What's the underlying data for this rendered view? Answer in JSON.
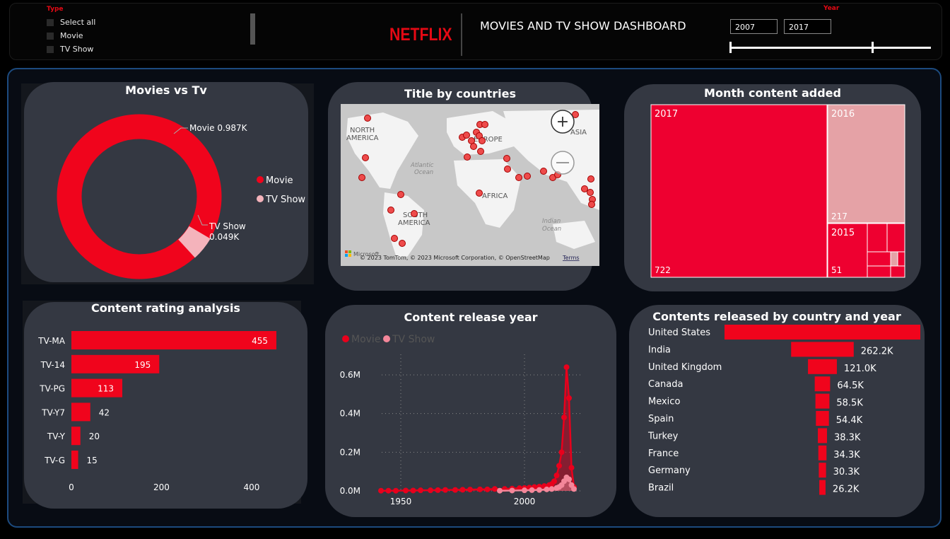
{
  "header": {
    "type_label": "Type",
    "type_options": [
      "Select all",
      "Movie",
      "TV Show"
    ],
    "logo": "NETFLIX",
    "title": "MOVIES AND TV SHOW DASHBOARD",
    "year_label": "Year",
    "year_start": "2007",
    "year_end": "2017"
  },
  "donut": {
    "title": "Movies vs Tv",
    "legend": [
      "Movie",
      "TV Show"
    ],
    "label_movie": "Movie 0.987K",
    "label_tv_line1": "TV Show",
    "label_tv_line2": "0.049K",
    "colors": {
      "Movie": "#f0041c",
      "TV Show": "#f4b3bb"
    }
  },
  "map": {
    "title": "Title by countries",
    "labels": {
      "north_america": "NORTH AMERICA",
      "europe": "EUROPE",
      "asia": "ASIA",
      "africa": "AFRICA",
      "south_america": "SOUTH AMERICA",
      "atlantic": "Atlantic Ocean",
      "indian": "Indian Ocean"
    },
    "attribution": "© 2023 TomTom, © 2023 Microsoft Corporation, © OpenStreetMap",
    "terms": "Terms",
    "ms_logo_text": "Microsoft"
  },
  "treemap": {
    "title": "Month content added",
    "tiles": [
      {
        "label": "2017",
        "value": "722",
        "color": "#ee0030"
      },
      {
        "label": "2016",
        "value": "217",
        "color": "#e5a2a6"
      },
      {
        "label": "2015",
        "value": "51",
        "color": "#ee0030"
      }
    ]
  },
  "chart_data": [
    {
      "type": "donut",
      "title": "Movies vs Tv",
      "categories": [
        "Movie",
        "TV Show"
      ],
      "values": [
        987,
        49
      ],
      "legend": "right"
    },
    {
      "type": "bar",
      "orientation": "horizontal",
      "title": "Content rating analysis",
      "categories": [
        "TV-MA",
        "TV-14",
        "TV-PG",
        "TV-Y7",
        "TV-Y",
        "TV-G"
      ],
      "values": [
        455,
        195,
        113,
        42,
        20,
        15
      ],
      "xticks": [
        "0",
        "200",
        "400"
      ],
      "xlim": [
        0,
        470
      ],
      "color": "#f0041c"
    },
    {
      "type": "line",
      "title": "Content release year",
      "legend": [
        "Movie",
        "TV Show"
      ],
      "series_colors": {
        "Movie": "#e8001c",
        "TV Show": "#f4879a"
      },
      "yticks": [
        "0.0M",
        "0.2M",
        "0.4M",
        "0.6M"
      ],
      "xticks": [
        "1950",
        "2000"
      ],
      "xlim": [
        1940,
        2022
      ],
      "ylim": [
        0,
        0.7
      ],
      "series": [
        {
          "name": "Movie",
          "x": [
            1942,
            1945,
            1948,
            1952,
            1955,
            1958,
            1962,
            1965,
            1968,
            1972,
            1975,
            1978,
            1982,
            1985,
            1988,
            1992,
            1995,
            1998,
            2000,
            2002,
            2004,
            2006,
            2008,
            2010,
            2011,
            2012,
            2013,
            2014,
            2015,
            2016,
            2017,
            2018,
            2019,
            2020
          ],
          "y": [
            0.001,
            0.001,
            0.001,
            0.002,
            0.002,
            0.003,
            0.003,
            0.004,
            0.005,
            0.005,
            0.006,
            0.007,
            0.008,
            0.008,
            0.01,
            0.01,
            0.012,
            0.014,
            0.015,
            0.017,
            0.02,
            0.022,
            0.025,
            0.03,
            0.035,
            0.05,
            0.08,
            0.13,
            0.2,
            0.38,
            0.64,
            0.48,
            0.12,
            0.02
          ]
        },
        {
          "name": "TV Show",
          "x": [
            1990,
            1995,
            2000,
            2003,
            2006,
            2009,
            2011,
            2013,
            2014,
            2015,
            2016,
            2017,
            2018,
            2019,
            2020
          ],
          "y": [
            0.001,
            0.002,
            0.003,
            0.004,
            0.005,
            0.008,
            0.01,
            0.015,
            0.02,
            0.03,
            0.05,
            0.07,
            0.06,
            0.03,
            0.01
          ]
        }
      ]
    },
    {
      "type": "bar",
      "orientation": "horizontal",
      "title": "Contents released by country and year",
      "categories": [
        "United States",
        "India",
        "United Kingdom",
        "Canada",
        "Mexico",
        "Spain",
        "Turkey",
        "France",
        "Germany",
        "Brazil"
      ],
      "values": [
        820,
        262.2,
        121.0,
        64.5,
        58.5,
        54.4,
        38.3,
        34.3,
        30.3,
        26.2
      ],
      "value_labels": [
        "",
        "262.2K",
        "121.0K",
        "64.5K",
        "58.5K",
        "54.4K",
        "38.3K",
        "34.3K",
        "30.3K",
        "26.2K"
      ],
      "color": "#f0041c"
    }
  ]
}
